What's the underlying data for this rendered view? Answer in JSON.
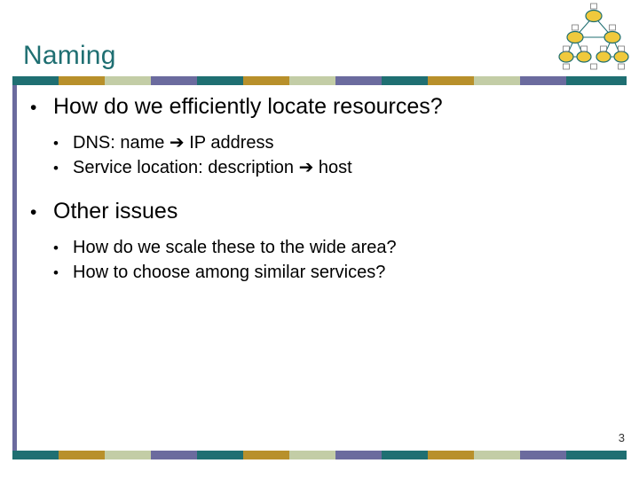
{
  "slide": {
    "title": "Naming",
    "page_number": "3",
    "bullets": [
      {
        "level": 1,
        "marker": "•",
        "text": "How do we efficiently locate resources?"
      },
      {
        "level": 2,
        "marker": "•",
        "text": "DNS: name ➔ IP address"
      },
      {
        "level": 2,
        "marker": "•",
        "text": "Service location: description ➔ host"
      },
      {
        "level": 1,
        "marker": "•",
        "text": "Other issues"
      },
      {
        "level": 2,
        "marker": "•",
        "text": "How do we scale these to the wide area?"
      },
      {
        "level": 2,
        "marker": "•",
        "text": "How to choose among similar services?"
      }
    ],
    "colors": {
      "title": "#1f6f72",
      "teal": "#1f6f72",
      "gold": "#b8902b",
      "sage": "#c3cda6",
      "purple": "#6b6b9e",
      "left_bar": "#6b6b9e",
      "node_fill": "#f0c93c",
      "node_stroke": "#1f6f72"
    },
    "strip_top": [
      {
        "color": "#1f6f72",
        "width": 52
      },
      {
        "color": "#b8902b",
        "width": 52
      },
      {
        "color": "#c3cda6",
        "width": 52
      },
      {
        "color": "#6b6b9e",
        "width": 52
      },
      {
        "color": "#1f6f72",
        "width": 52
      },
      {
        "color": "#b8902b",
        "width": 52
      },
      {
        "color": "#c3cda6",
        "width": 52
      },
      {
        "color": "#6b6b9e",
        "width": 52
      },
      {
        "color": "#1f6f72",
        "width": 52
      },
      {
        "color": "#b8902b",
        "width": 52
      },
      {
        "color": "#c3cda6",
        "width": 52
      },
      {
        "color": "#6b6b9e",
        "width": 52
      },
      {
        "color": "#1f6f72",
        "width": 68
      }
    ],
    "strip_bottom": [
      {
        "color": "#1f6f72",
        "width": 52
      },
      {
        "color": "#b8902b",
        "width": 52
      },
      {
        "color": "#c3cda6",
        "width": 52
      },
      {
        "color": "#6b6b9e",
        "width": 52
      },
      {
        "color": "#1f6f72",
        "width": 52
      },
      {
        "color": "#b8902b",
        "width": 52
      },
      {
        "color": "#c3cda6",
        "width": 52
      },
      {
        "color": "#6b6b9e",
        "width": 52
      },
      {
        "color": "#1f6f72",
        "width": 52
      },
      {
        "color": "#b8902b",
        "width": 52
      },
      {
        "color": "#c3cda6",
        "width": 52
      },
      {
        "color": "#6b6b9e",
        "width": 52
      },
      {
        "color": "#1f6f72",
        "width": 68
      }
    ]
  }
}
